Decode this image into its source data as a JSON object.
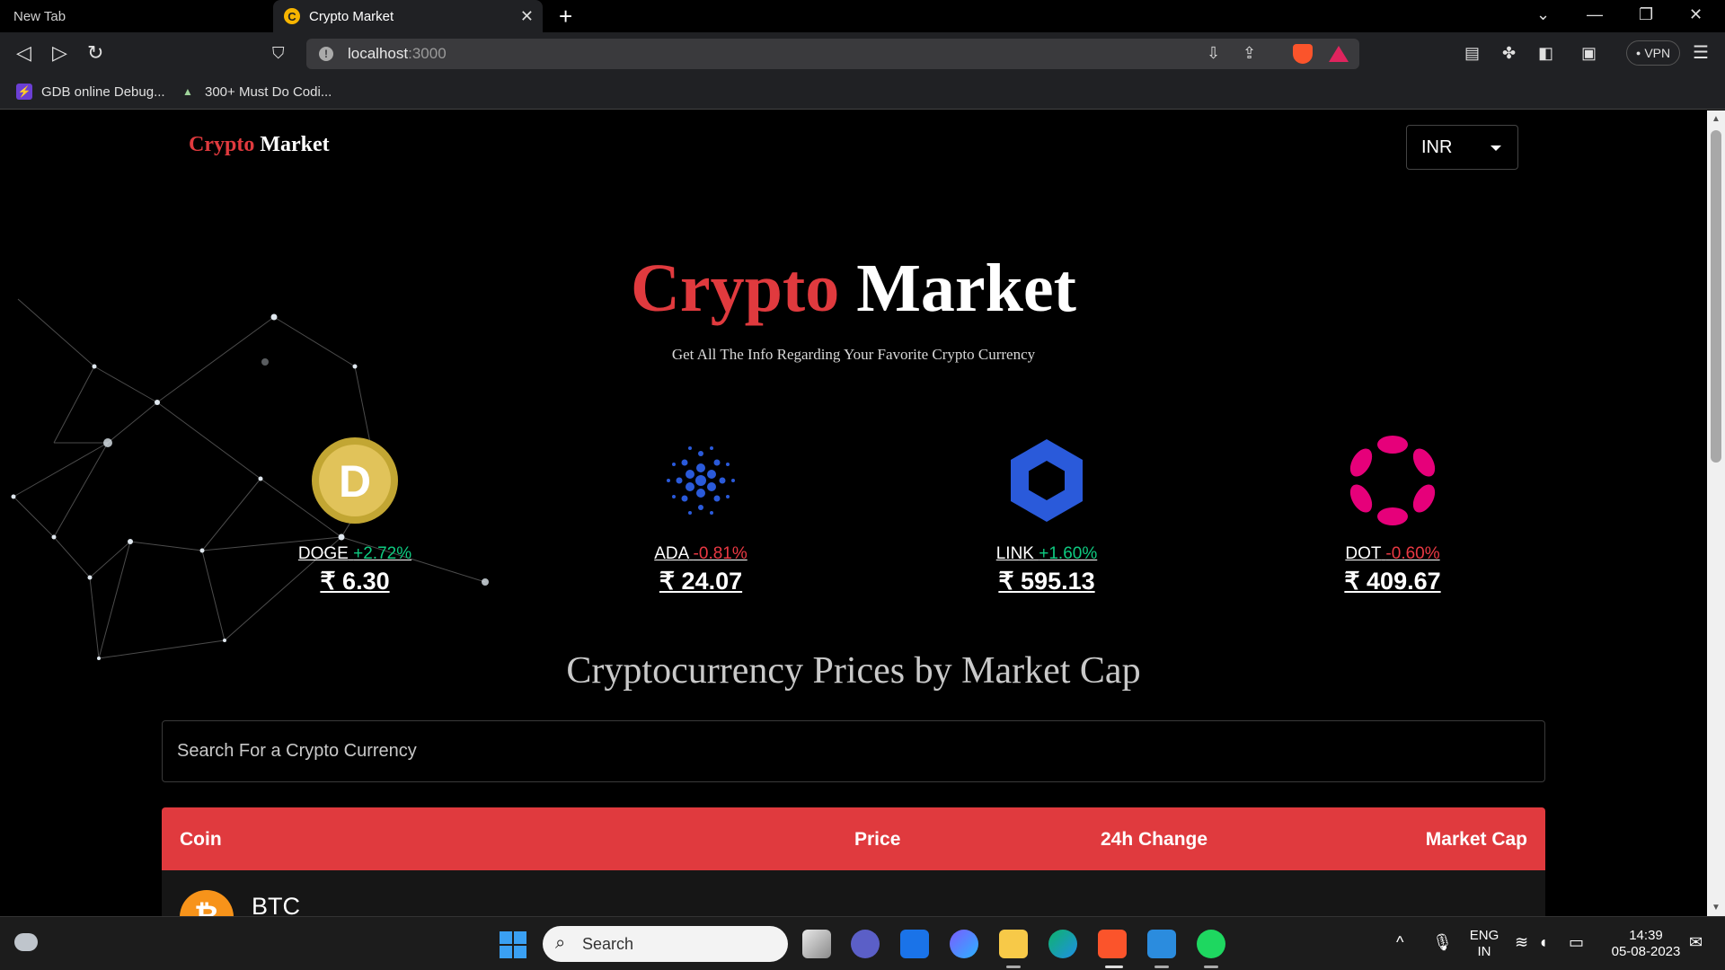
{
  "browser": {
    "tabs": [
      {
        "title": "New Tab"
      },
      {
        "title": "Crypto Market",
        "favicon": "C"
      }
    ],
    "url": {
      "host": "localhost",
      "port": ":3000"
    },
    "vpn_label": "VPN",
    "bookmarks": [
      {
        "label": "GDB online Debug..."
      },
      {
        "label": "300+ Must Do Codi..."
      }
    ]
  },
  "page": {
    "brand": {
      "part1": "Crypto",
      "part2": " Market"
    },
    "currency": "INR",
    "hero": {
      "title_part1": "Crypto",
      "title_part2": " Market",
      "subtitle": "Get All The Info Regarding Your Favorite Crypto Currency"
    },
    "trending": [
      {
        "symbol": "DOGE",
        "change": "+2.72%",
        "price": "₹ 6.30",
        "direction": "up"
      },
      {
        "symbol": "ADA",
        "change": "-0.81%",
        "price": "₹ 24.07",
        "direction": "down"
      },
      {
        "symbol": "LINK",
        "change": "+1.60%",
        "price": "₹ 595.13",
        "direction": "up"
      },
      {
        "symbol": "DOT",
        "change": "-0.60%",
        "price": "₹ 409.67",
        "direction": "down"
      }
    ],
    "section_title": "Cryptocurrency Prices by Market Cap",
    "search_placeholder": "Search For a Crypto Currency",
    "table": {
      "headers": [
        "Coin",
        "Price",
        "24h Change",
        "Market Cap"
      ],
      "rows": [
        {
          "symbol": "BTC",
          "logo": "₿"
        }
      ]
    },
    "colors": {
      "accent": "#e03a3e",
      "up": "#0ecb81",
      "down": "#ea3943"
    }
  },
  "taskbar": {
    "search_label": "Search",
    "lang_line1": "ENG",
    "lang_line2": "IN",
    "time": "14:39",
    "date": "05-08-2023"
  }
}
